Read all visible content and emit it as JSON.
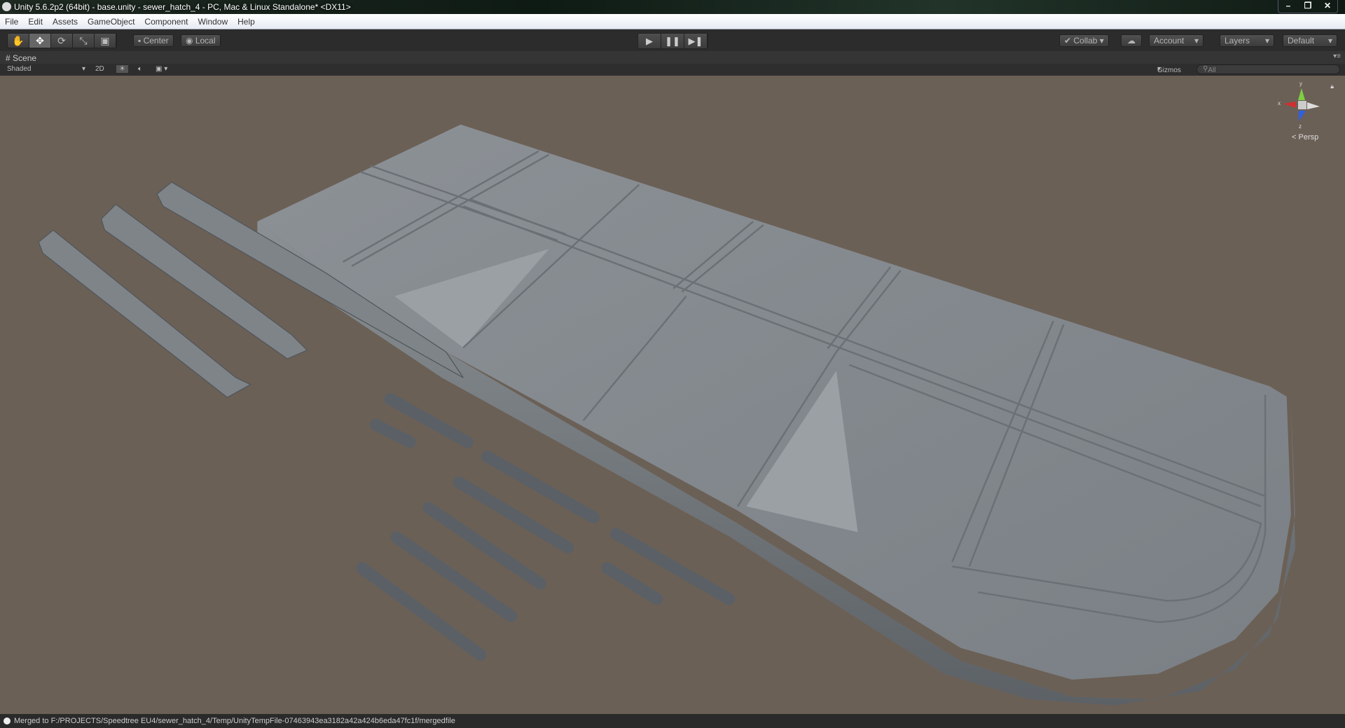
{
  "window": {
    "title": "Unity 5.6.2p2 (64bit) - base.unity - sewer_hatch_4 - PC, Mac & Linux Standalone* <DX11>",
    "controls": [
      "–",
      "❐",
      "✕"
    ]
  },
  "menu": [
    "File",
    "Edit",
    "Assets",
    "GameObject",
    "Component",
    "Window",
    "Help"
  ],
  "toolbar": {
    "tools": [
      {
        "name": "hand",
        "glyph": "✋"
      },
      {
        "name": "move",
        "glyph": "✥"
      },
      {
        "name": "rotate",
        "glyph": "⟳"
      },
      {
        "name": "scale",
        "glyph": "⤡"
      },
      {
        "name": "rect",
        "glyph": "▣"
      }
    ],
    "pivot": "Center",
    "space": "Local",
    "play": "▶",
    "pause": "❚❚",
    "step": "▶❚",
    "collab": "Collab",
    "account": "Account",
    "layers": "Layers",
    "layout": "Default"
  },
  "scene": {
    "tab": "Scene",
    "shading": "Shaded",
    "mode_2d": "2D",
    "gizmos": "Gizmos",
    "search_placeholder": "All",
    "projection": "Persp",
    "axes": {
      "x": "x",
      "y": "y",
      "z": "z"
    }
  },
  "status": {
    "message": "Merged to F:/PROJECTS/Speedtree EU4/sewer_hatch_4/Temp/UnityTempFile-07463943ea3182a42a424b6eda47fc1f/mergedfile"
  }
}
